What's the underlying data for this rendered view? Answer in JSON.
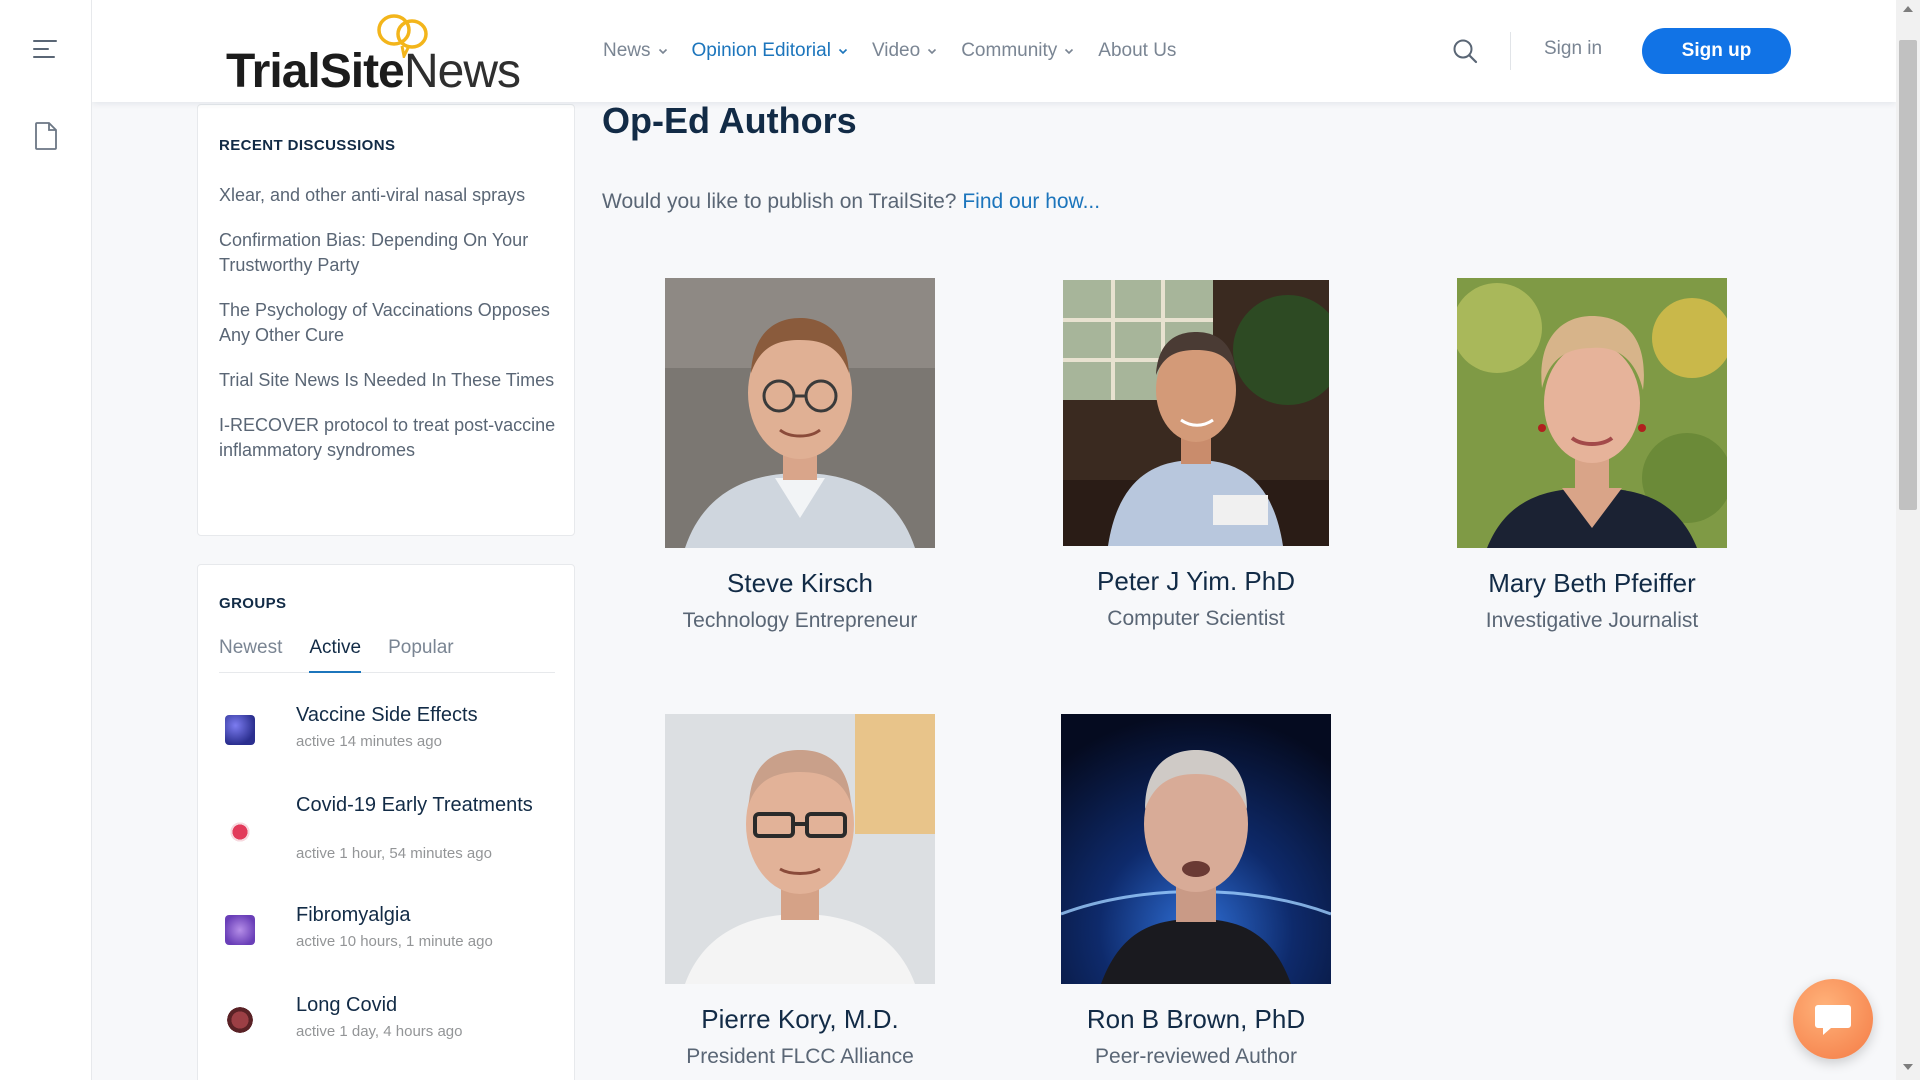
{
  "logo": {
    "part1": "TrialSite",
    "part2": "News"
  },
  "nav": {
    "items": [
      {
        "label": "News",
        "has_dropdown": true
      },
      {
        "label": "Opinion Editorial",
        "has_dropdown": true,
        "active": true
      },
      {
        "label": "Video",
        "has_dropdown": true
      },
      {
        "label": "Community",
        "has_dropdown": true
      },
      {
        "label": "About Us",
        "has_dropdown": false
      }
    ],
    "sign_in": "Sign in",
    "sign_up": "Sign up"
  },
  "recent": {
    "title": "RECENT DISCUSSIONS",
    "items": [
      "Xlear, and other anti-viral nasal sprays",
      "Confirmation Bias: Depending On Your Trustworthy Party",
      "The Psychology of Vaccinations Opposes Any Other Cure",
      "Trial Site News Is Needed In These Times",
      "I-RECOVER protocol to treat post-vaccine inflammatory syndromes"
    ]
  },
  "groups": {
    "title": "GROUPS",
    "tabs": [
      "Newest",
      "Active",
      "Popular"
    ],
    "active_tab": "Active",
    "items": [
      {
        "name": "Vaccine Side Effects",
        "meta": "active 14 minutes ago",
        "thumb": "virus-blue"
      },
      {
        "name": "Covid-19 Early Treatments",
        "meta": "active 1 hour, 54 minutes ago",
        "thumb": "virus-red"
      },
      {
        "name": "Fibromyalgia",
        "meta": "active 10 hours, 1 minute ago",
        "thumb": "butterfly-purple"
      },
      {
        "name": "Long Covid",
        "meta": "active 1 day, 4 hours ago",
        "thumb": "virus-dark"
      }
    ]
  },
  "main": {
    "title": "Op-Ed Authors",
    "publish_prompt": "Would you like to publish on TrailSite?",
    "publish_link": "Find our how...",
    "authors": [
      {
        "name": "Steve Kirsch",
        "role": "Technology Entrepreneur"
      },
      {
        "name": "Peter J Yim. PhD",
        "role": "Computer Scientist"
      },
      {
        "name": "Mary Beth Pfeiffer",
        "role": "Investigative Journalist"
      },
      {
        "name": "Pierre Kory, M.D.",
        "role": "President FLCC Alliance"
      },
      {
        "name": "Ron B Brown, PhD",
        "role": "Peer-reviewed Author"
      }
    ]
  },
  "colors": {
    "accent": "#1c75bc",
    "signup_bg": "#1173e6",
    "heading": "#122b46",
    "muted": "#5a6675",
    "chat_bubble": "#f47b45"
  },
  "icons": [
    "menu-icon",
    "document-icon",
    "search-icon",
    "chevron-down-icon",
    "chat-icon"
  ]
}
